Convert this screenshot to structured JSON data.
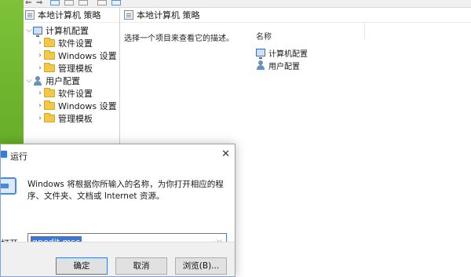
{
  "gpedit": {
    "tree_header": "本地计算机 策略",
    "tree": [
      {
        "label": "计算机配置"
      },
      {
        "label": "软件设置"
      },
      {
        "label": "Windows 设置"
      },
      {
        "label": "管理模板"
      },
      {
        "label": "用户配置"
      },
      {
        "label": "软件设置"
      },
      {
        "label": "Windows 设置"
      },
      {
        "label": "管理模板"
      }
    ],
    "content_header": "本地计算机 策略",
    "description": "选择一个项目来查看它的描述。",
    "column_name": "名称",
    "items": [
      {
        "label": "计算机配置"
      },
      {
        "label": "用户配置"
      }
    ]
  },
  "run": {
    "title": "运行",
    "close_glyph": "✕",
    "description": "Windows 将根据你所输入的名称，为你打开相应的程序、文件夹、文档或 Internet 资源。",
    "open_label": "打开",
    "open_label_visible": "打开",
    "input_value": "gpedit.msc",
    "ok": "确定",
    "cancel": "取消",
    "browse": "浏览(B)..."
  }
}
